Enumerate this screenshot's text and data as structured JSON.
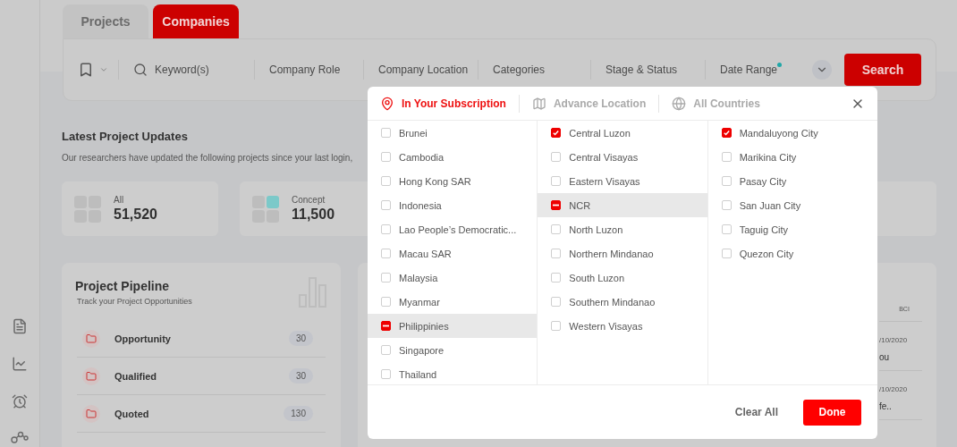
{
  "tabs": [
    {
      "label": "Projects",
      "selected": false
    },
    {
      "label": "Companies",
      "selected": true
    }
  ],
  "filter_bar": {
    "keyword_placeholder": "Keyword(s)",
    "filters": [
      {
        "label": "Company Role",
        "indicator": false
      },
      {
        "label": "Company Location",
        "indicator": false
      },
      {
        "label": "Categories",
        "indicator": false
      },
      {
        "label": "Stage & Status",
        "indicator": false
      },
      {
        "label": "Date Range",
        "indicator": true
      }
    ],
    "search_button": "Search"
  },
  "updates": {
    "title": "Latest Project Updates",
    "subtitle": "Our researchers have updated the following projects since your last login,",
    "stats": [
      {
        "label": "All",
        "value": "51,520",
        "highlight": false
      },
      {
        "label": "Concept",
        "value": "11,500",
        "highlight": true
      }
    ]
  },
  "pipeline": {
    "title": "Project Pipeline",
    "subtitle": "Track your Project Opportunities",
    "stages": [
      {
        "label": "Opportunity",
        "count": "30"
      },
      {
        "label": "Qualified",
        "count": "30"
      },
      {
        "label": "Quoted",
        "count": "130"
      }
    ]
  },
  "side_panel": {
    "column": "BCI",
    "entries": [
      {
        "date": "/10/2020",
        "text": "ou"
      },
      {
        "date": "/10/2020",
        "text": "fe.."
      }
    ]
  },
  "location_modal": {
    "tabs": [
      {
        "label": "In Your Subscription",
        "selected": true
      },
      {
        "label": "Advance Location",
        "selected": false
      },
      {
        "label": "All Countries",
        "selected": false
      }
    ],
    "columns": [
      {
        "items": [
          {
            "kind": "checkbox",
            "label": "Brunei",
            "checked": false,
            "selected": false
          },
          {
            "kind": "checkbox",
            "label": "Cambodia",
            "checked": false,
            "selected": false
          },
          {
            "kind": "checkbox",
            "label": "Hong Kong SAR",
            "checked": false,
            "selected": false
          },
          {
            "kind": "checkbox",
            "label": "Indonesia",
            "checked": false,
            "selected": false
          },
          {
            "kind": "checkbox",
            "label": "Lao People’s Democratic...",
            "checked": false,
            "selected": false
          },
          {
            "kind": "checkbox",
            "label": "Macau SAR",
            "checked": false,
            "selected": false
          },
          {
            "kind": "checkbox",
            "label": "Malaysia",
            "checked": false,
            "selected": false
          },
          {
            "kind": "checkbox",
            "label": "Myanmar",
            "checked": false,
            "selected": false
          },
          {
            "kind": "indeterminate",
            "label": "Philippinies",
            "checked": true,
            "selected": true
          },
          {
            "kind": "checkbox",
            "label": "Singapore",
            "checked": false,
            "selected": false
          },
          {
            "kind": "checkbox",
            "label": "Thailand",
            "checked": false,
            "selected": false
          }
        ]
      },
      {
        "items": [
          {
            "kind": "checkbox",
            "label": "Central Luzon",
            "checked": true,
            "selected": false
          },
          {
            "kind": "checkbox",
            "label": "Central Visayas",
            "checked": false,
            "selected": false
          },
          {
            "kind": "checkbox",
            "label": "Eastern Visayas",
            "checked": false,
            "selected": false
          },
          {
            "kind": "indeterminate",
            "label": "NCR",
            "checked": true,
            "selected": true
          },
          {
            "kind": "checkbox",
            "label": "North Luzon",
            "checked": false,
            "selected": false
          },
          {
            "kind": "checkbox",
            "label": "Northern Mindanao",
            "checked": false,
            "selected": false
          },
          {
            "kind": "checkbox",
            "label": "South Luzon",
            "checked": false,
            "selected": false
          },
          {
            "kind": "checkbox",
            "label": "Southern Mindanao",
            "checked": false,
            "selected": false
          },
          {
            "kind": "checkbox",
            "label": "Western Visayas",
            "checked": false,
            "selected": false
          }
        ]
      },
      {
        "items": [
          {
            "kind": "checkbox",
            "label": "Mandaluyong City",
            "checked": true,
            "selected": false
          },
          {
            "kind": "checkbox",
            "label": "Marikina City",
            "checked": false,
            "selected": false
          },
          {
            "kind": "checkbox",
            "label": "Pasay City",
            "checked": false,
            "selected": false
          },
          {
            "kind": "checkbox",
            "label": "San Juan City",
            "checked": false,
            "selected": false
          },
          {
            "kind": "checkbox",
            "label": "Taguig City",
            "checked": false,
            "selected": false
          },
          {
            "kind": "checkbox",
            "label": "Quezon City",
            "checked": false,
            "selected": false
          }
        ]
      }
    ],
    "clear_button": "Clear All",
    "done_button": "Done"
  }
}
